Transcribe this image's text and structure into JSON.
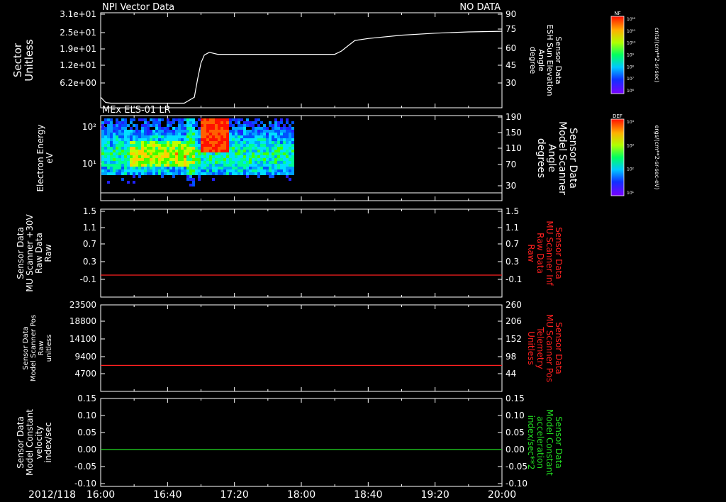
{
  "colors": {
    "white": "#ffffff",
    "red": "#ff2020",
    "green": "#22dd22",
    "bg": "#000000"
  },
  "chart_data": [
    {
      "type": "line",
      "panel_title_left": "NPI Vector Data",
      "panel_title_right": "NO DATA",
      "ylabel_left": [
        "Sector",
        "Unitless"
      ],
      "ylabel_right": [
        "Sensor Data",
        "ESH Sun Elevation",
        "Angle",
        "degree"
      ],
      "right_color": "#ffffff",
      "yticks_left": [
        "3.1e+01",
        "2.5e+01",
        "1.9e+01",
        "1.2e+01",
        "6.2e+00"
      ],
      "yticks_right": [
        "90",
        "75",
        "60",
        "45",
        "30"
      ],
      "ylim_right": [
        18,
        90
      ],
      "series": [
        {
          "x": [
            0,
            3,
            6,
            10,
            20,
            50,
            56,
            58,
            60,
            62,
            65,
            70,
            100,
            140,
            144,
            148,
            152,
            160,
            180,
            200,
            220,
            240
          ],
          "y": [
            26,
            22,
            21.5,
            21.5,
            21.5,
            21.5,
            26,
            40,
            52,
            58,
            60,
            58.5,
            58.5,
            58.5,
            61,
            65,
            69,
            70.5,
            73,
            74.5,
            75.5,
            76
          ]
        }
      ]
    },
    {
      "type": "heatmap",
      "panel_title_left": "MEx ELS-01 LR",
      "ylabel_left": [
        "Electron Energy",
        "eV"
      ],
      "ylabel_right": [
        "Sensor Data",
        "Model Scanner",
        "Angle",
        "degrees"
      ],
      "right_color": "#ffffff",
      "yticks_left": [
        "10²",
        "10¹"
      ],
      "yticks_right": [
        "190",
        "150",
        "110",
        "70",
        "30"
      ],
      "ylim_right": [
        0,
        190
      ],
      "data_x_range_min": [
        0,
        115
      ],
      "description_band": "electron flux spectrogram"
    },
    {
      "type": "line",
      "ylabel_left": [
        "Sensor Data",
        "MU Scanner +30V",
        "Raw Data",
        "Raw"
      ],
      "ylabel_right": [
        "Sensor Data",
        "MU Scanner Inf",
        "Raw Data",
        "Raw"
      ],
      "right_color": "#ff2020",
      "yticks_left": [
        "1.5",
        "1.1",
        "0.7",
        "0.3",
        "-0.1"
      ],
      "yticks_right": [
        "1.5",
        "1.1",
        "0.7",
        "0.3",
        "-0.1"
      ],
      "ylim": [
        -0.5,
        1.5
      ],
      "series": [
        {
          "x": [
            0,
            240
          ],
          "y": [
            0,
            0
          ],
          "color": "#ff2020"
        }
      ]
    },
    {
      "type": "line",
      "ylabel_left": [
        "Sensor Data",
        "Model Scanner Pos",
        "Raw",
        "unitless"
      ],
      "ylabel_right": [
        "Sensor Data",
        "MU Scanner Pos",
        "Telemetry",
        "Unitless"
      ],
      "right_color": "#ff2020",
      "yticks_left": [
        "23500",
        "18800",
        "14100",
        "9400",
        "4700"
      ],
      "yticks_right": [
        "260",
        "206",
        "152",
        "98",
        "44"
      ],
      "ylim": [
        0,
        23500
      ],
      "series": [
        {
          "x": [
            0,
            240
          ],
          "y": [
            7050,
            7050
          ],
          "color": "#ff2020"
        }
      ]
    },
    {
      "type": "line",
      "ylabel_left": [
        "Sensor Data",
        "Model Constant",
        "velocity",
        "index/sec"
      ],
      "ylabel_right": [
        "Sensor Data",
        "Model Constant",
        "acceleration",
        "index/sec**2"
      ],
      "right_color": "#22dd22",
      "yticks_left": [
        "0.15",
        "0.10",
        "0.05",
        "0.00",
        "-0.05",
        "-0.10"
      ],
      "yticks_right": [
        "0.15",
        "0.10",
        "0.05",
        "0.00",
        "-0.05",
        "-0.10"
      ],
      "ylim": [
        -0.1,
        0.15
      ],
      "series": [
        {
          "x": [
            0,
            240
          ],
          "y": [
            0,
            0
          ],
          "color": "#22dd22"
        }
      ]
    }
  ],
  "xaxis": {
    "date": "2012/118",
    "ticks": [
      "16:00",
      "16:40",
      "17:20",
      "18:00",
      "18:40",
      "19:20",
      "20:00"
    ]
  },
  "colorbars": [
    {
      "tag": "NF",
      "unit": "cnts/(cm**2-sr-sec)",
      "ticks": [
        "10¹²",
        "10¹¹",
        "10¹⁰",
        "10⁹",
        "10⁸",
        "10⁷",
        "10⁶"
      ]
    },
    {
      "tag": "DEF",
      "unit": "ergs/(cm**2-sr-sec-eV)",
      "ticks": [
        "10⁴",
        "10³",
        "10²",
        "10¹"
      ]
    }
  ]
}
